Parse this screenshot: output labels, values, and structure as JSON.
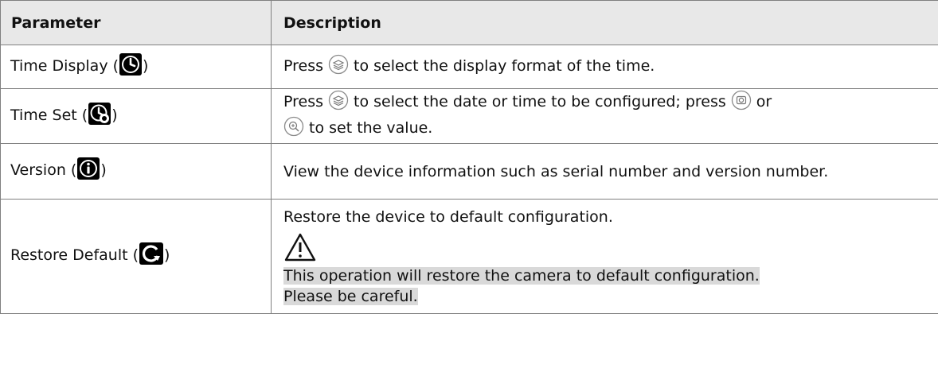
{
  "headers": {
    "parameter": "Parameter",
    "description": "Description"
  },
  "rows": [
    {
      "param": "Time Display (",
      "param_icon": "clock-icon",
      "close": ")",
      "desc_a": "Press",
      "desc_btn_1": "layers-button-icon",
      "desc_b": "to select the display format of the time."
    },
    {
      "param": "Time Set (",
      "param_icon": "clock-set-icon",
      "close": ")",
      "desc_a": "Press",
      "desc_btn_1": "layers-button-icon",
      "desc_b": "to select the date or time to be configured; press",
      "desc_btn_2": "snapshot-button-icon",
      "desc_c": "or",
      "desc_btn_3": "zoom-button-icon",
      "desc_d": "to set the value."
    },
    {
      "param": "Version (",
      "param_icon": "info-icon",
      "close": ")",
      "desc": "View the device information such as serial number and version number."
    },
    {
      "param": "Restore Default (",
      "param_icon": "restore-icon",
      "close": ")",
      "desc": "Restore the device to default configuration.",
      "warning_icon": "warning-icon",
      "note_1": "This operation will restore the camera to default configuration.",
      "note_2": "Please be careful."
    }
  ]
}
